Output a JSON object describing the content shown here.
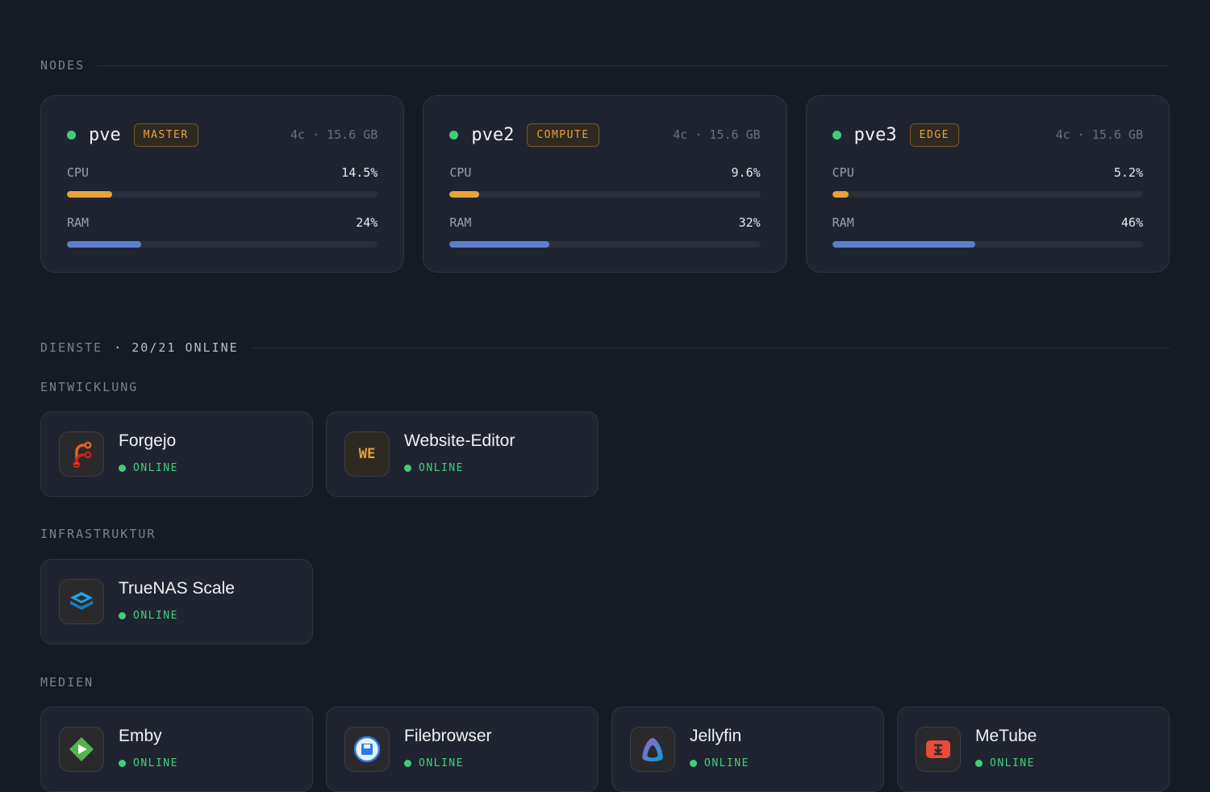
{
  "nodes_section": {
    "title": "NODES"
  },
  "nodes": [
    {
      "name": "pve",
      "role": "MASTER",
      "spec": "4c · 15.6 GB",
      "cpu_label": "CPU",
      "cpu_value": "14.5%",
      "cpu_pct": 14.5,
      "ram_label": "RAM",
      "ram_value": "24%",
      "ram_pct": 24
    },
    {
      "name": "pve2",
      "role": "COMPUTE",
      "spec": "4c · 15.6 GB",
      "cpu_label": "CPU",
      "cpu_value": "9.6%",
      "cpu_pct": 9.6,
      "ram_label": "RAM",
      "ram_value": "32%",
      "ram_pct": 32
    },
    {
      "name": "pve3",
      "role": "EDGE",
      "spec": "4c · 15.6 GB",
      "cpu_label": "CPU",
      "cpu_value": "5.2%",
      "cpu_pct": 5.2,
      "ram_label": "RAM",
      "ram_value": "46%",
      "ram_pct": 46
    }
  ],
  "services_section": {
    "title": "DIENSTE",
    "count": "· 20/21 ONLINE"
  },
  "groups": {
    "entwicklung": {
      "label": "ENTWICKLUNG",
      "services": [
        {
          "name": "Forgejo",
          "status": "ONLINE",
          "icon": "forgejo-icon"
        },
        {
          "name": "Website-Editor",
          "status": "ONLINE",
          "icon": "we-icon",
          "icon_text": "WE"
        }
      ]
    },
    "infrastruktur": {
      "label": "INFRASTRUKTUR",
      "services": [
        {
          "name": "TrueNAS Scale",
          "status": "ONLINE",
          "icon": "truenas-icon"
        }
      ]
    },
    "medien": {
      "label": "MEDIEN",
      "services": [
        {
          "name": "Emby",
          "status": "ONLINE",
          "icon": "emby-icon"
        },
        {
          "name": "Filebrowser",
          "status": "ONLINE",
          "icon": "filebrowser-icon"
        },
        {
          "name": "Jellyfin",
          "status": "ONLINE",
          "icon": "jellyfin-icon"
        },
        {
          "name": "MeTube",
          "status": "ONLINE",
          "icon": "metube-icon"
        }
      ]
    }
  },
  "colors": {
    "online": "#3ecf7c",
    "cpu_bar": "#e8a23a",
    "ram_bar": "#5b7fd0",
    "role": "#e6a23a"
  }
}
